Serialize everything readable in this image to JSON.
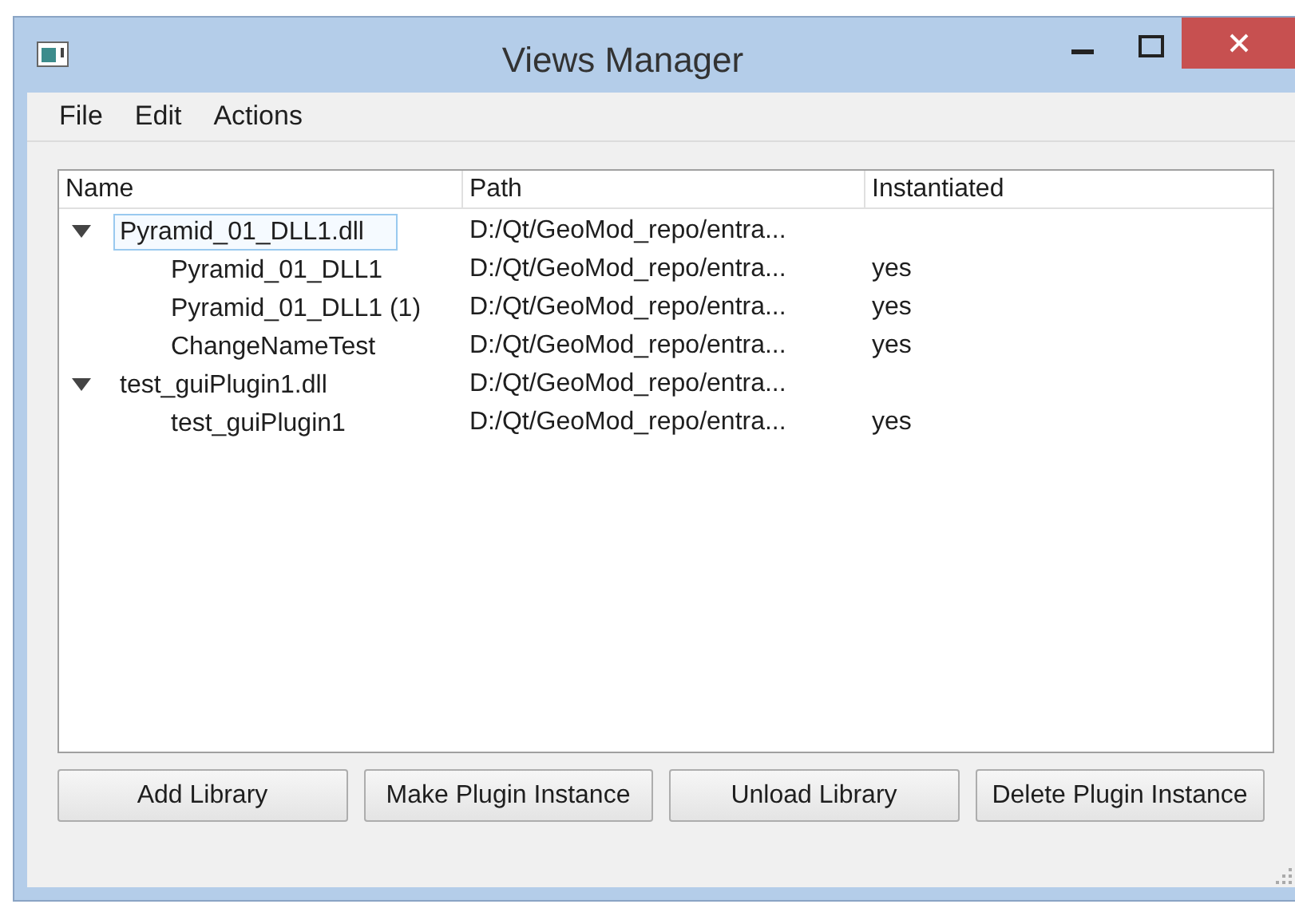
{
  "window": {
    "title": "Views Manager"
  },
  "menu": [
    "File",
    "Edit",
    "Actions"
  ],
  "tree": {
    "columns": [
      "Name",
      "Path",
      "Instantiated"
    ],
    "items": [
      {
        "name": "Pyramid_01_DLL1.dll",
        "path": "D:/Qt/GeoMod_repo/entra...",
        "expanded": true,
        "selected": true,
        "children": [
          {
            "name": "Pyramid_01_DLL1",
            "path": "D:/Qt/GeoMod_repo/entra...",
            "instantiated": "yes",
            "selected": false
          },
          {
            "name": "Pyramid_01_DLL1 (1)",
            "path": "D:/Qt/GeoMod_repo/entra...",
            "instantiated": "yes",
            "selected": false
          },
          {
            "name": "ChangeNameTest",
            "path": "D:/Qt/GeoMod_repo/entra...",
            "instantiated": "yes",
            "selected": false
          }
        ]
      },
      {
        "name": "test_guiPlugin1.dll",
        "path": "D:/Qt/GeoMod_repo/entra...",
        "expanded": true,
        "selected": false,
        "children": [
          {
            "name": "test_guiPlugin1",
            "path": "D:/Qt/GeoMod_repo/entra...",
            "instantiated": "yes",
            "selected": false
          }
        ]
      }
    ]
  },
  "buttons": [
    "Add Library",
    "Make Plugin Instance",
    "Unload Library",
    "Delete Plugin Instance"
  ]
}
